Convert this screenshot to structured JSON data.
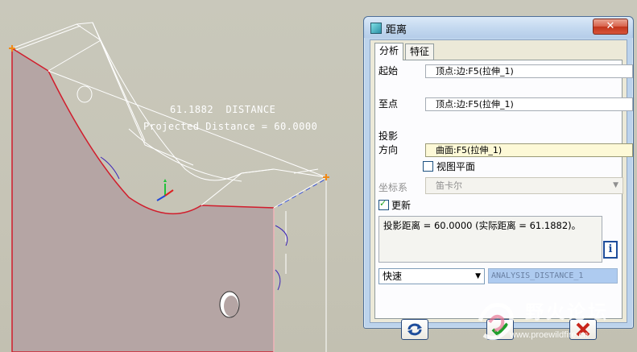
{
  "viewport": {
    "measure_label": "61.1882  DISTANCE",
    "projected_label": "Projected Distance = 60.0000"
  },
  "dialog": {
    "title": "距离",
    "close_label": "✕",
    "tabs": [
      "分析",
      "特征"
    ],
    "from_label": "起始",
    "from_value": "顶点:边:F5(拉伸_1)",
    "to_label": "至点",
    "to_value": "顶点:边:F5(拉伸_1)",
    "projection_label_1": "投影",
    "projection_label_2": "方向",
    "projection_value": "曲面:F5(拉伸_1)",
    "view_plane_label": "视图平面",
    "view_plane_checked": false,
    "coord_label": "坐标系",
    "coord_value": "笛卡尔",
    "update_label": "更新",
    "update_checked": true,
    "result_text": "投影距离 = 60.0000 (实际距离 = 61.1882)。",
    "mode_value": "快速",
    "name_value": "ANALYSIS_DISTANCE_1",
    "info_icon": "i"
  },
  "watermark": {
    "text": "野火论坛",
    "url": "www.proewildfire.cn"
  }
}
